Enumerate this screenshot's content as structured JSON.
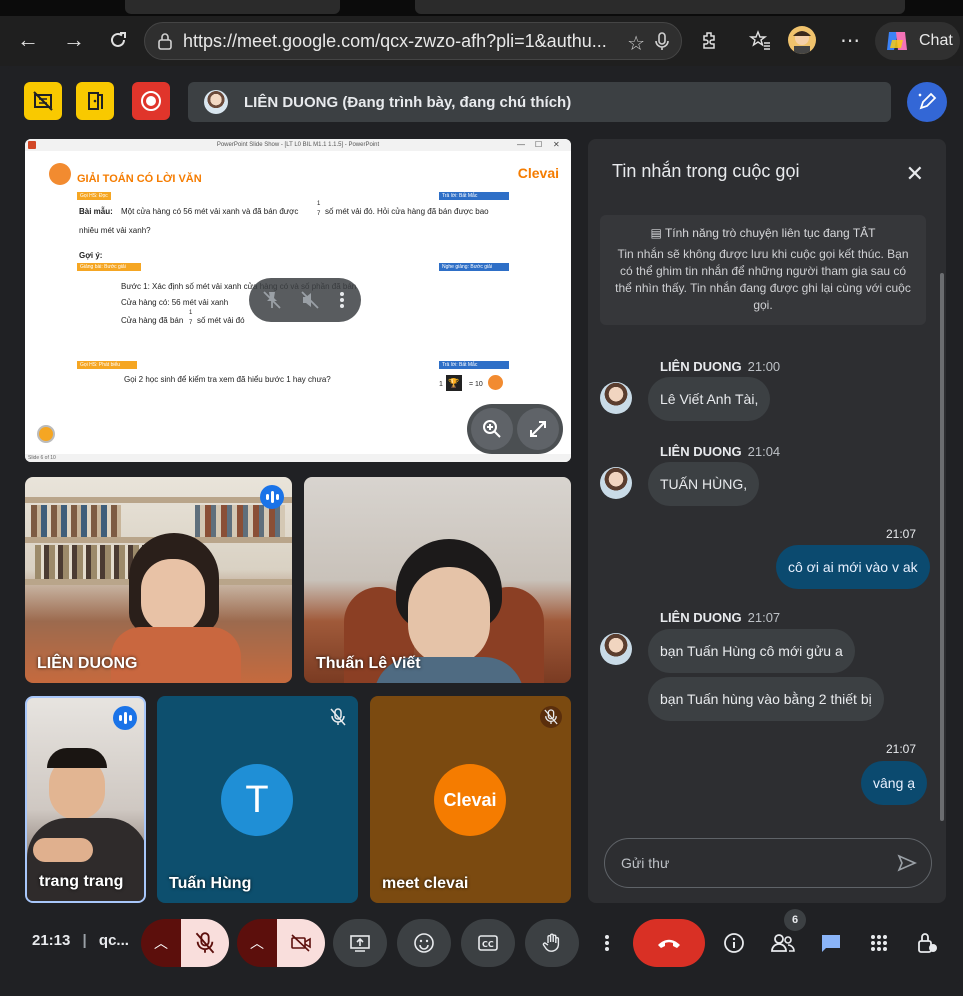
{
  "browser": {
    "url": "https://meet.google.com/qcx-zwzo-afh?pli=1&authu...",
    "chat_label": "Chat"
  },
  "presenter": {
    "label": "LIÊN DUONG (Đang trình bày, đang chú thích)"
  },
  "slide": {
    "window_title": "PowerPoint Slide Show - [LT L0 BIL M1.1 1.1.5] - PowerPoint",
    "title": "GIẢI TOÁN CÓ LỜI VĂN",
    "logo": "Clevai",
    "tag_goi_hs_doc": "Gọi HS: Đọc",
    "tag_tra_loi_1": "Trả lời: Bất Mắc",
    "bai_mau_label": "Bài mẫu:",
    "bai_mau_text_1": "Một cửa hàng có 56 mét vải xanh và đã bán được",
    "bai_mau_frac_num": "1",
    "bai_mau_frac_den": "7",
    "bai_mau_text_2": "số mét vải đó. Hỏi cửa hàng đã bán được bao",
    "bai_mau_text_3": "nhiêu mét vải xanh?",
    "goi_y": "Gợi ý:",
    "tag_giang_bai": "Giảng bài: Bước giải",
    "tag_nghe_giang": "Nghe giảng: Bước giải",
    "buoc_1": "Bước 1: Xác định số mét vải xanh cửa hàng có và số phần đã bán",
    "line_2": "Cửa hàng có: 56 mét vải xanh",
    "line_3a": "Cửa hàng đã bán",
    "line_3b": "số mét vải đó",
    "tag_phat_bieu": "Gọi HS: Phát biểu",
    "tag_tra_loi_2": "Trả lời: Bất Mắc",
    "goi_hoc_sinh": "Gọi 2 học sinh để kiểm tra xem đã hiểu bước 1 hay chưa?",
    "score": "= 10",
    "score_prefix": "1",
    "status": "Slide 6 of 10"
  },
  "tiles": [
    {
      "name": "LIÊN DUONG"
    },
    {
      "name": "Thuấn Lê Viết"
    },
    {
      "name": "trang trang"
    },
    {
      "name": "Tuấn Hùng",
      "initial": "T"
    },
    {
      "name": "meet clevai",
      "logo": "Clevai"
    }
  ],
  "chat": {
    "title": "Tin nhắn trong cuộc gọi",
    "notice_title": "Tính năng trò chuyện liên tục đang TẮT",
    "notice_body": "Tin nhắn sẽ không được lưu khi cuộc gọi kết thúc. Bạn có thể ghim tin nhắn để những người tham gia sau có thể nhìn thấy. Tin nhắn đang được ghi lại cùng với cuộc gọi.",
    "messages": [
      {
        "sender": "LIÊN DUONG",
        "time": "21:00",
        "text": "Lê Viết Anh Tài,"
      },
      {
        "sender": "LIÊN DUONG",
        "time": "21:04",
        "text": "TUẤN HÙNG,"
      },
      {
        "sender": "",
        "time": "21:07",
        "text": "cô ơi ai mới vào v ak"
      },
      {
        "sender": "LIÊN DUONG",
        "time": "21:07",
        "text": "bạn Tuấn Hùng cô mới gửu a"
      },
      {
        "sender": "",
        "time": "",
        "text": "bạn Tuấn hùng vào bằng 2 thiết bị"
      },
      {
        "sender": "",
        "time": "21:07",
        "text": "vâng ạ"
      }
    ],
    "input_placeholder": "Gửi thư"
  },
  "bottom": {
    "clock": "21:13",
    "meeting_code": "qc...",
    "participants_count": "6"
  },
  "colors": {
    "accent_yellow": "#f9c900",
    "record_red": "#e0352b",
    "end_call": "#d93025",
    "my_bubble": "#0b4a6f"
  }
}
